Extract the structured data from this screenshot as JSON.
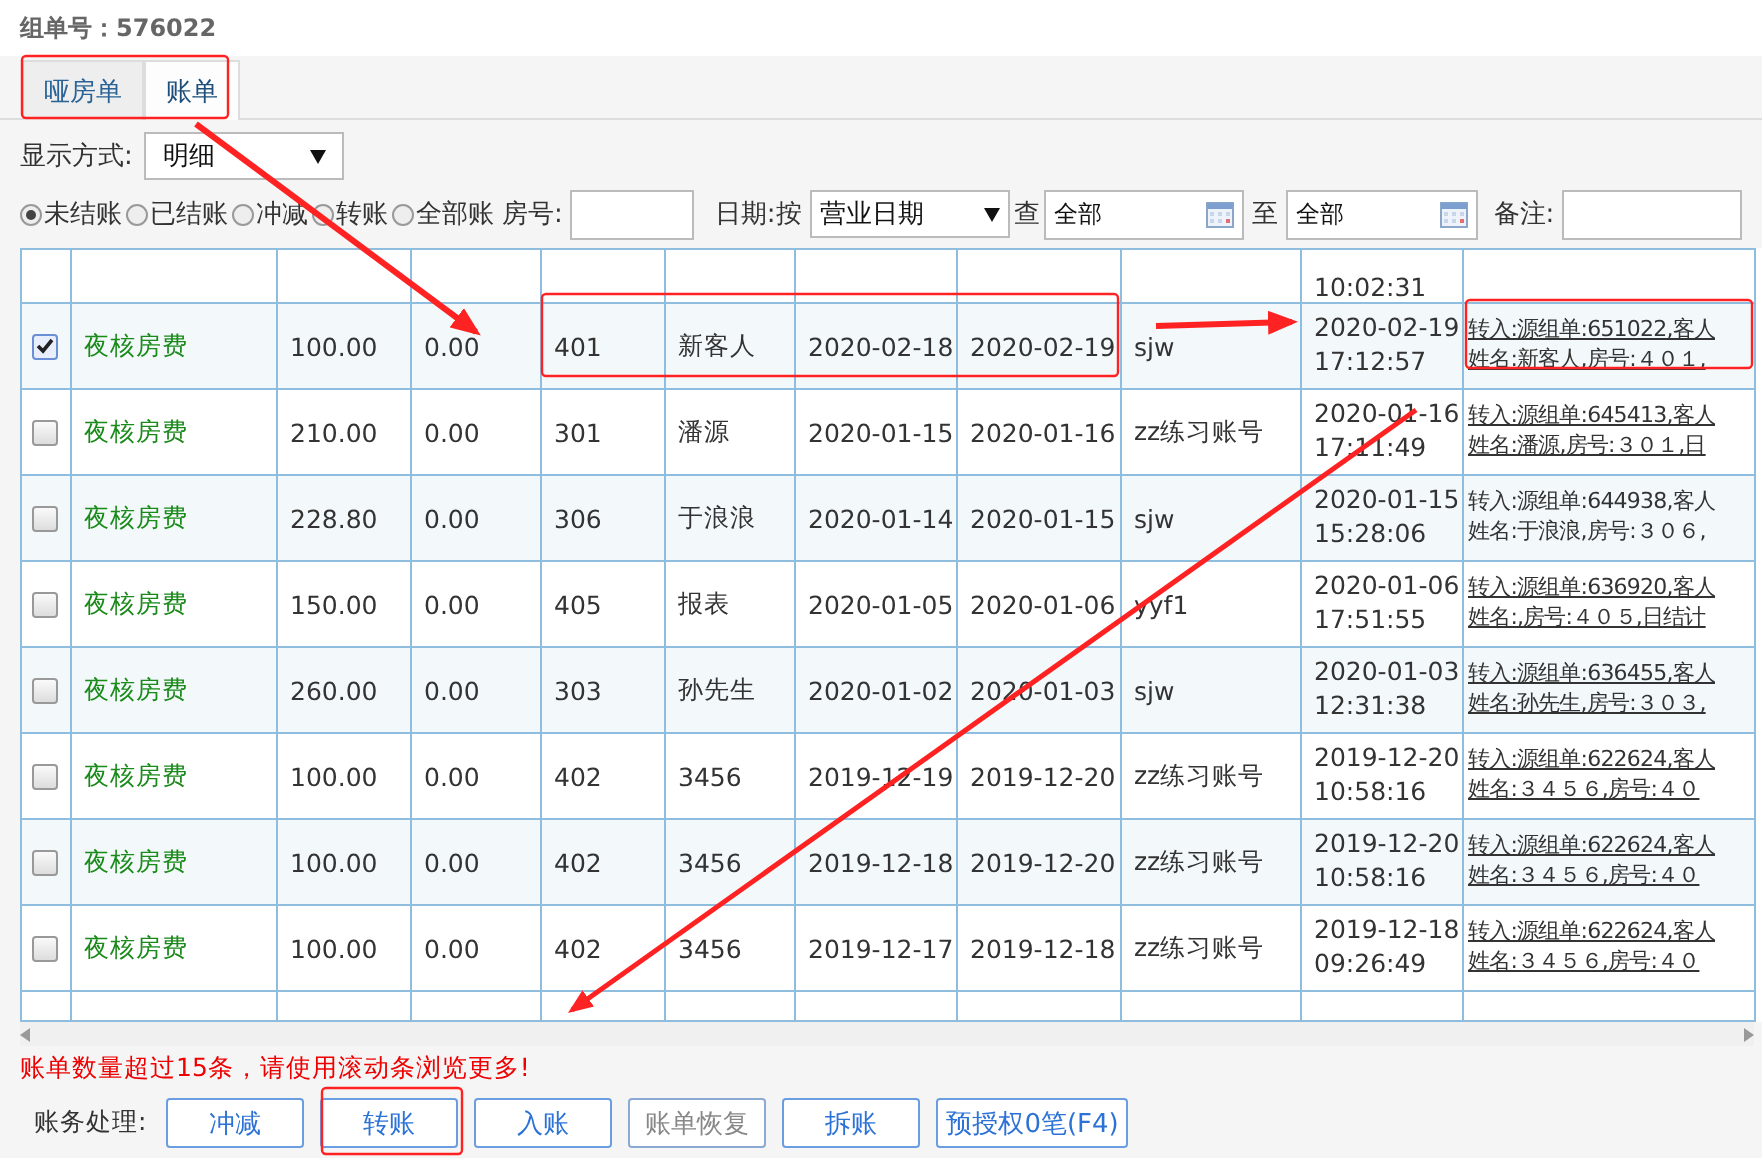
{
  "header": "组单号：576022",
  "tabs": [
    {
      "label": "哑房单",
      "selected": false
    },
    {
      "label": "账单",
      "selected": true
    }
  ],
  "display_mode": {
    "label": "显示方式:",
    "value": "明细"
  },
  "filters": {
    "radios": [
      {
        "label": "未结账",
        "selected": true
      },
      {
        "label": "已结账",
        "selected": false
      },
      {
        "label": "冲减",
        "selected": false
      },
      {
        "label": "转账",
        "selected": false
      },
      {
        "label": "全部账",
        "selected": false
      }
    ],
    "room_label": "房号:",
    "date_label": "日期:按",
    "date_basis": "营业日期",
    "from_label": "查",
    "from_value": "全部",
    "to_label": "至",
    "to_value": "全部",
    "remark_label": "备注:"
  },
  "table": {
    "top_cut_time": "10:02:31",
    "rows": [
      {
        "checked": true,
        "item": "夜核房费",
        "amount": "100.00",
        "column_3": "0.00",
        "room": "401",
        "guest": "新客人",
        "date_1": "2020-02-18",
        "date_2": "2020-02-19",
        "operator": "sjw",
        "time": [
          "2020-02-19",
          "17:12:57"
        ],
        "remark": [
          "转入:源组单:651022,客人",
          "姓名:新客人,房号:４０１,"
        ],
        "underlined": true
      },
      {
        "checked": false,
        "item": "夜核房费",
        "amount": "210.00",
        "column_3": "0.00",
        "room": "301",
        "guest": "潘源",
        "date_1": "2020-01-15",
        "date_2": "2020-01-16",
        "operator": "zz练习账号",
        "time": [
          "2020-01-16",
          "17:11:49"
        ],
        "remark": [
          "转入:源组单:645413,客人",
          "姓名:潘源,房号:３０１,日"
        ],
        "underlined": true
      },
      {
        "checked": false,
        "item": "夜核房费",
        "amount": "228.80",
        "column_3": "0.00",
        "room": "306",
        "guest": "于浪浪",
        "date_1": "2020-01-14",
        "date_2": "2020-01-15",
        "operator": "sjw",
        "time": [
          "2020-01-15",
          "15:28:06"
        ],
        "remark": [
          "转入:源组单:644938,客人",
          "姓名:于浪浪,房号:３０６,"
        ],
        "underlined": false
      },
      {
        "checked": false,
        "item": "夜核房费",
        "amount": "150.00",
        "column_3": "0.00",
        "room": "405",
        "guest": "报表",
        "date_1": "2020-01-05",
        "date_2": "2020-01-06",
        "operator": "yyf1",
        "time": [
          "2020-01-06",
          "17:51:55"
        ],
        "remark": [
          "转入:源组单:636920,客人",
          "姓名:,房号:４０５,日结计"
        ],
        "underlined": true
      },
      {
        "checked": false,
        "item": "夜核房费",
        "amount": "260.00",
        "column_3": "0.00",
        "room": "303",
        "guest": "孙先生",
        "date_1": "2020-01-02",
        "date_2": "2020-01-03",
        "operator": "sjw",
        "time": [
          "2020-01-03",
          "12:31:38"
        ],
        "remark": [
          "转入:源组单:636455,客人",
          "姓名:孙先生,房号:３０３,"
        ],
        "underlined": true
      },
      {
        "checked": false,
        "item": "夜核房费",
        "amount": "100.00",
        "column_3": "0.00",
        "room": "402",
        "guest": "3456",
        "date_1": "2019-12-19",
        "date_2": "2019-12-20",
        "operator": "zz练习账号",
        "time": [
          "2019-12-20",
          "10:58:16"
        ],
        "remark": [
          "转入:源组单:622624,客人",
          "姓名:３４５６,房号:４０"
        ],
        "underlined": true
      },
      {
        "checked": false,
        "item": "夜核房费",
        "amount": "100.00",
        "column_3": "0.00",
        "room": "402",
        "guest": "3456",
        "date_1": "2019-12-18",
        "date_2": "2019-12-20",
        "operator": "zz练习账号",
        "time": [
          "2019-12-20",
          "10:58:16"
        ],
        "remark": [
          "转入:源组单:622624,客人",
          "姓名:３４５６,房号:４０"
        ],
        "underlined": true
      },
      {
        "checked": false,
        "item": "夜核房费",
        "amount": "100.00",
        "column_3": "0.00",
        "room": "402",
        "guest": "3456",
        "date_1": "2019-12-17",
        "date_2": "2019-12-18",
        "operator": "zz练习账号",
        "time": [
          "2019-12-18",
          "09:26:49"
        ],
        "remark": [
          "转入:源组单:622624,客人",
          "姓名:３４５６,房号:４０"
        ],
        "underlined": true
      }
    ]
  },
  "notice": "账单数量超过15条，请使用滚动条浏览更多!",
  "actions": {
    "label": "账务处理:",
    "buttons": [
      {
        "label": "冲减",
        "disabled": false
      },
      {
        "label": "转账",
        "disabled": false
      },
      {
        "label": "入账",
        "disabled": false
      },
      {
        "label": "账单恢复",
        "disabled": true
      },
      {
        "label": "拆账",
        "disabled": false
      },
      {
        "label": "预授权0笔(F4)",
        "disabled": false
      }
    ]
  }
}
